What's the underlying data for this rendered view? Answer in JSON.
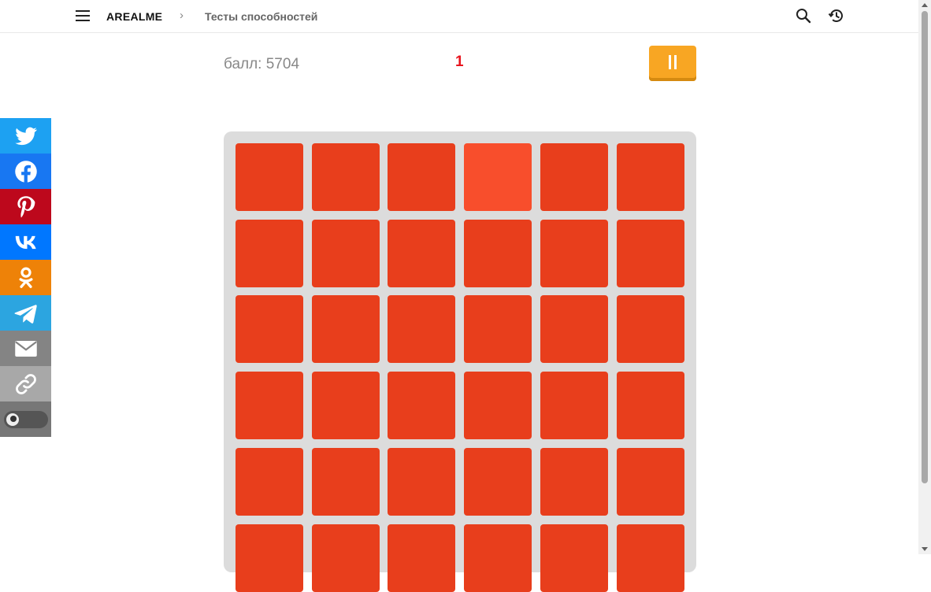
{
  "header": {
    "brand": "AREALME",
    "breadcrumb_separator": "›",
    "breadcrumb": "Тесты способностей",
    "icons": [
      "menu-icon",
      "search-icon",
      "history-icon"
    ]
  },
  "share": {
    "items": [
      {
        "name": "twitter",
        "color": "#1da1f2"
      },
      {
        "name": "facebook",
        "color": "#1877f2"
      },
      {
        "name": "pinterest",
        "color": "#bd081c"
      },
      {
        "name": "vk",
        "color": "#0077ff"
      },
      {
        "name": "odnoklassniki",
        "color": "#ee8208"
      },
      {
        "name": "telegram",
        "color": "#2ca5e0"
      },
      {
        "name": "email",
        "color": "#848484"
      },
      {
        "name": "link",
        "color": "#a8a8a8"
      },
      {
        "name": "dark-mode-toggle",
        "color": "#777777"
      }
    ]
  },
  "game": {
    "score_text": "балл: 5704",
    "level": "1",
    "pause_icon": "pause-icon",
    "grid": {
      "columns": 6,
      "visible_rows": 6,
      "base_color": "#e83e1c",
      "odd_color": "#f84e2c",
      "odd_tile": {
        "row": 0,
        "col": 3
      }
    }
  },
  "colors": {
    "accent": "#f8a623",
    "level": "#e8141e",
    "board_bg": "#dcdcdc"
  }
}
